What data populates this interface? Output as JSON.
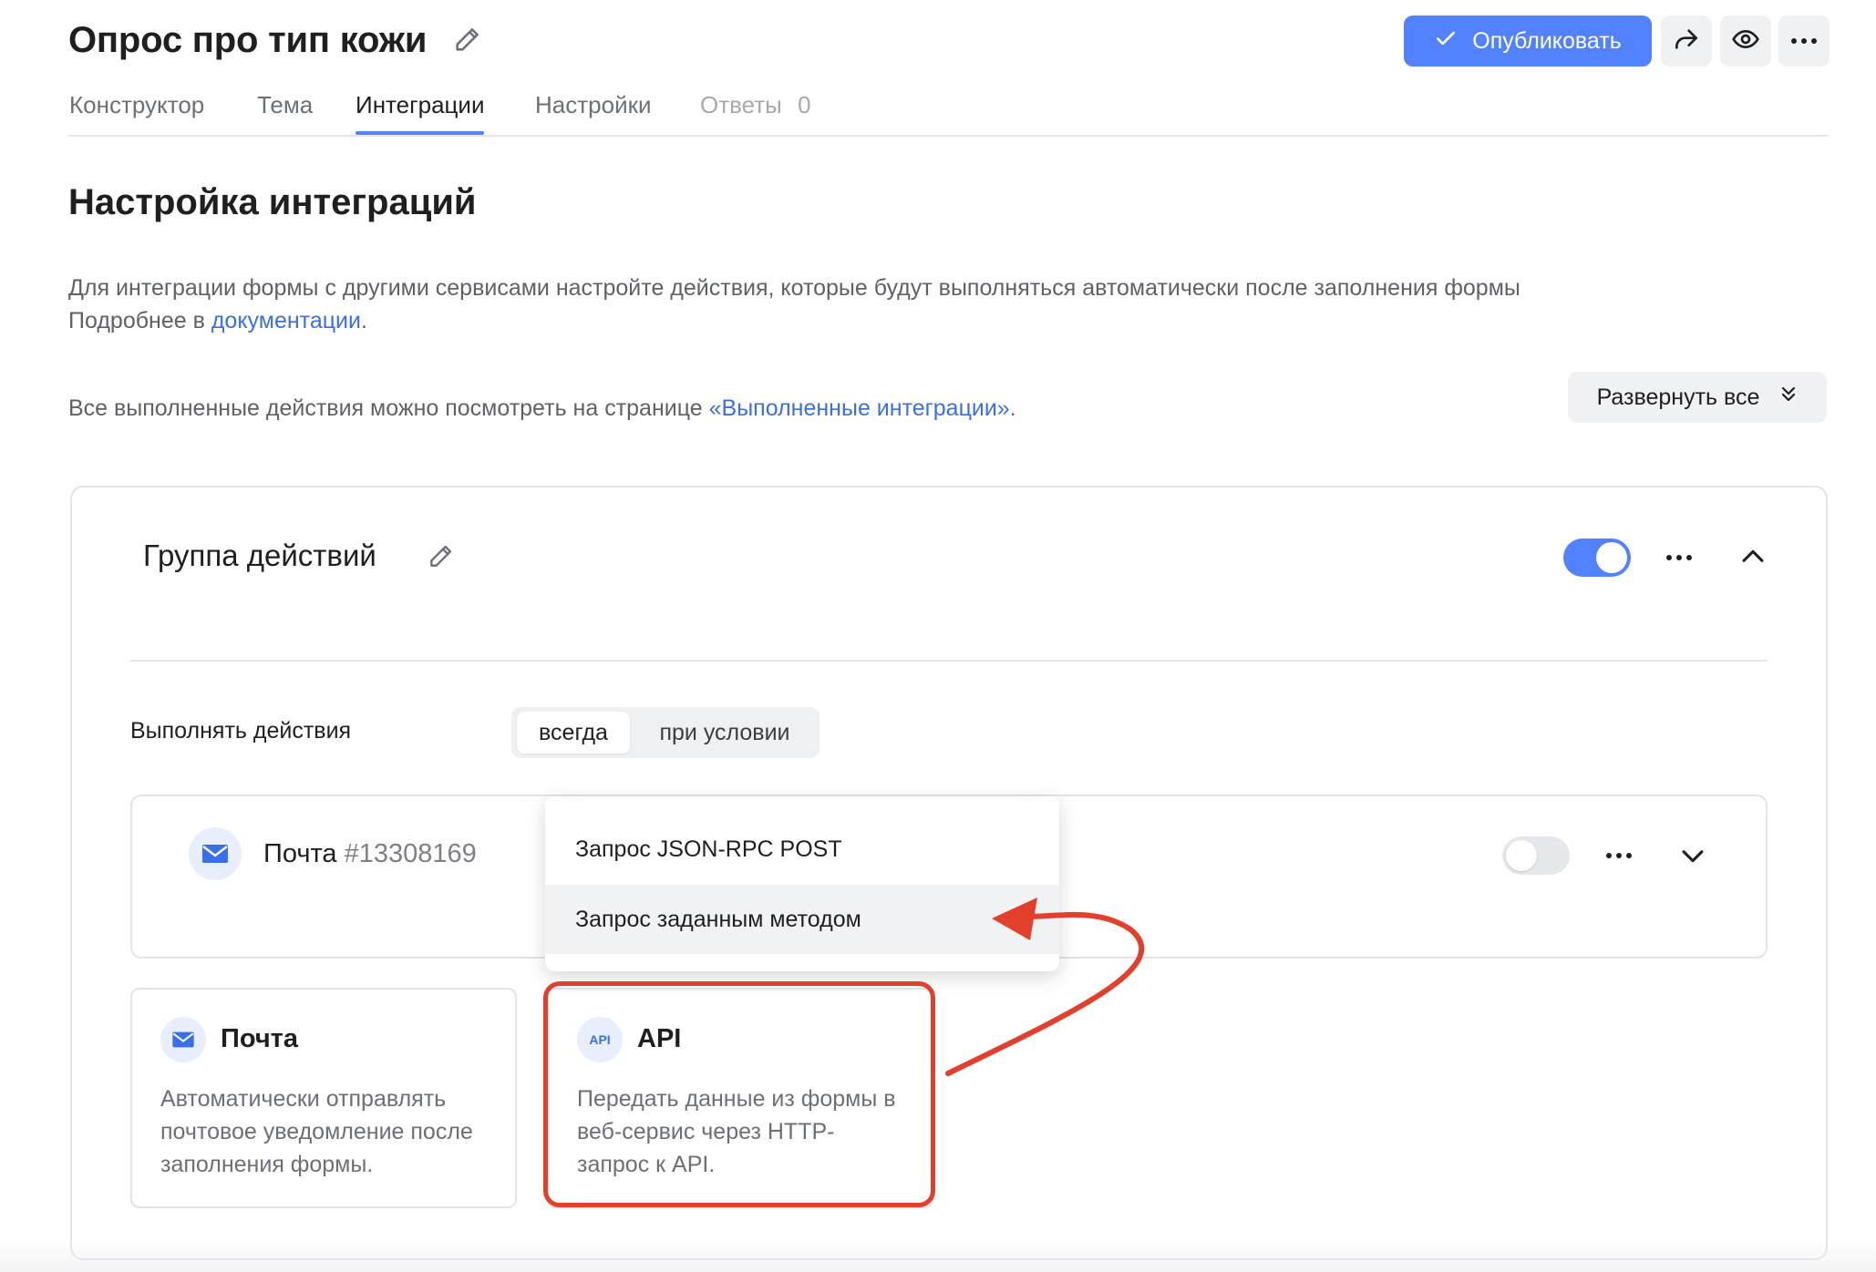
{
  "header": {
    "form_title": "Опрос про тип кожи",
    "publish_label": "Опубликовать"
  },
  "tabs": [
    {
      "label": "Конструктор"
    },
    {
      "label": "Тема"
    },
    {
      "label": "Интеграции",
      "active": true
    },
    {
      "label": "Настройки"
    },
    {
      "label": "Ответы",
      "count": "0"
    }
  ],
  "integrations": {
    "title": "Настройка интеграций",
    "description": "Для интеграции формы с другими сервисами настройте действия, которые будут выполняться автоматически после заполнения формы",
    "more_prefix": "Подробнее в ",
    "more_link": "документации",
    "more_suffix": ".",
    "done_prefix": "Все выполненные действия можно посмотреть на странице ",
    "done_link": "«Выполненные интеграции».",
    "expand_all": "Развернуть все"
  },
  "group": {
    "title": "Группа действий",
    "enabled": true,
    "run_label": "Выполнять действия",
    "run_options": [
      "всегда",
      "при условии"
    ],
    "run_selected": "всегда"
  },
  "action": {
    "name": "Почта",
    "number": "#13308169",
    "enabled": false
  },
  "menu": {
    "items": [
      "Запрос JSON-RPC POST",
      "Запрос заданным методом"
    ],
    "hovered": "Запрос заданным методом"
  },
  "tiles": {
    "mail": {
      "name": "Почта",
      "icon": "envelope-icon",
      "description": "Автоматически отправлять почтовое уведомление после заполнения формы."
    },
    "api": {
      "name": "API",
      "badge": "API",
      "description": "Передать данные из формы в веб-сервис через HTTP-запрос к API."
    }
  },
  "colors": {
    "accent": "#5282ff",
    "link": "#3b6fe8",
    "annotation": "#e2402d"
  }
}
